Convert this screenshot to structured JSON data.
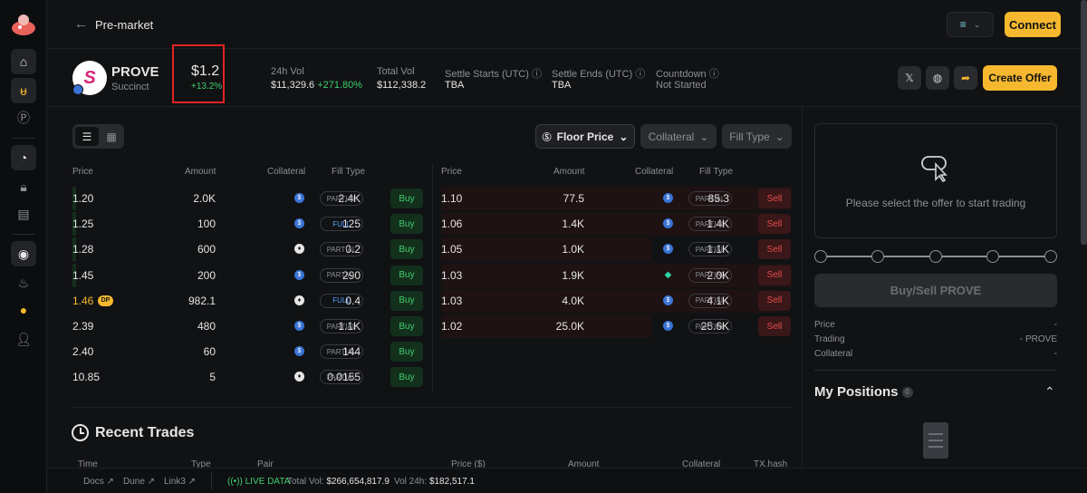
{
  "header": {
    "back_label": "←",
    "title": "Pre-market",
    "chain_selector": "≡",
    "connect_label": "Connect"
  },
  "token": {
    "symbol": "PROVE",
    "name": "Succinct",
    "price": "$1.2",
    "price_change": "+13.2%",
    "vol24_label": "24h Vol",
    "vol24_value": "$11,329.6",
    "vol24_change": "+271.80%",
    "total_vol_label": "Total Vol",
    "total_vol_value": "$112,338.2",
    "settle_starts_label": "Settle Starts (UTC)",
    "settle_starts_value": "TBA",
    "settle_ends_label": "Settle Ends (UTC)",
    "settle_ends_value": "TBA",
    "countdown_label": "Countdown",
    "countdown_value": "Not Started",
    "create_offer_label": "Create Offer"
  },
  "filters": {
    "floor_price": "Floor Price",
    "collateral": "Collateral",
    "fill_type": "Fill Type"
  },
  "buy_table": {
    "headers": [
      "Price",
      "Amount",
      "Collateral",
      "Fill Type"
    ],
    "rows": [
      {
        "price": "1.20",
        "amount": "2.0K",
        "collateral": "2.4K",
        "coin": "usdc",
        "fill": "PARTIAL",
        "action": "Buy",
        "dp": ""
      },
      {
        "price": "1.25",
        "amount": "100",
        "collateral": "125",
        "coin": "usdc",
        "fill": "FULL",
        "action": "Buy",
        "dp": ""
      },
      {
        "price": "1.28",
        "amount": "600",
        "collateral": "0.2",
        "coin": "eth",
        "fill": "PARTIAL",
        "action": "Buy",
        "dp": ""
      },
      {
        "price": "1.45",
        "amount": "200",
        "collateral": "290",
        "coin": "usdc",
        "fill": "PARTIAL",
        "action": "Buy",
        "dp": ""
      },
      {
        "price": "1.46",
        "amount": "982.1",
        "collateral": "0.4",
        "coin": "eth",
        "fill": "FULL",
        "action": "Buy",
        "dp": "DP"
      },
      {
        "price": "2.39",
        "amount": "480",
        "collateral": "1.1K",
        "coin": "usdc",
        "fill": "PARTIAL",
        "action": "Buy",
        "dp": ""
      },
      {
        "price": "2.40",
        "amount": "60",
        "collateral": "144",
        "coin": "usdc",
        "fill": "PARTIAL",
        "action": "Buy",
        "dp": ""
      },
      {
        "price": "10.85",
        "amount": "5",
        "collateral": "0.0155",
        "coin": "eth",
        "fill": "PARTIAL",
        "action": "Buy",
        "dp": ""
      }
    ]
  },
  "sell_table": {
    "headers": [
      "Price",
      "Amount",
      "Collateral",
      "Fill Type"
    ],
    "rows": [
      {
        "price": "1.10",
        "amount": "77.5",
        "collateral": "85.3",
        "coin": "usdc",
        "fill": "PARTIAL",
        "action": "Sell"
      },
      {
        "price": "1.06",
        "amount": "1.4K",
        "collateral": "1.4K",
        "coin": "usdc",
        "fill": "PARTIAL",
        "action": "Sell"
      },
      {
        "price": "1.05",
        "amount": "1.0K",
        "collateral": "1.1K",
        "coin": "usdc",
        "fill": "PARTIAL",
        "action": "Sell"
      },
      {
        "price": "1.03",
        "amount": "1.9K",
        "collateral": "2.0K",
        "coin": "gem",
        "fill": "PARTIAL",
        "action": "Sell"
      },
      {
        "price": "1.03",
        "amount": "4.0K",
        "collateral": "4.1K",
        "coin": "usdc",
        "fill": "PARTIAL",
        "action": "Sell"
      },
      {
        "price": "1.02",
        "amount": "25.0K",
        "collateral": "25.6K",
        "coin": "usdc",
        "fill": "PARTIAL",
        "action": "Sell"
      }
    ]
  },
  "recent_trades": {
    "title": "Recent Trades",
    "headers": [
      "Time",
      "Type",
      "Pair",
      "Price ($)",
      "Amount",
      "Collateral",
      "TX.hash"
    ]
  },
  "trade_panel": {
    "placeholder": "Please select the offer to start trading",
    "action_label": "Buy/Sell PROVE",
    "price_label": "Price",
    "price_value": "-",
    "trading_label": "Trading",
    "trading_value": "- PROVE",
    "collateral_label": "Collateral",
    "collateral_value": "-"
  },
  "positions": {
    "title": "My Positions",
    "count": "0"
  },
  "footer": {
    "docs": "Docs ↗",
    "dune": "Dune ↗",
    "link3": "Link3 ↗",
    "live": "LIVE DATA",
    "total_vol_label": "Total Vol:",
    "total_vol_value": "$266,654,817.9",
    "vol24_label": "Vol 24h:",
    "vol24_value": "$182,517.1"
  },
  "colors": {
    "accent": "#f5b82e",
    "buy": "#3fcf6c",
    "sell": "#e84b4b",
    "highlight_box": "#e02424"
  }
}
